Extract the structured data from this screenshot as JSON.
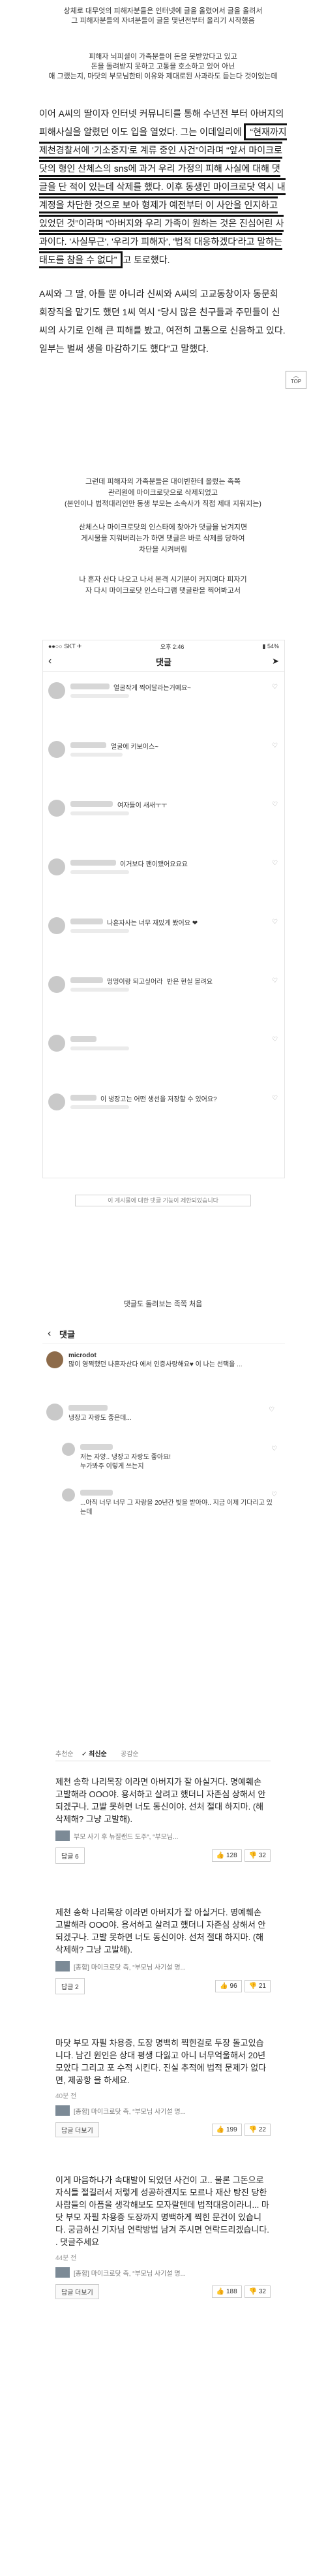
{
  "intro_lines": [
    "상체로 대무엇의 피해자분들은 인터넷에 글을 올렸어서 글을 올려서",
    "그 피해자분들의 자녀분들이 글을 몇년전부터 올리기 시작했음",
    "피해자 뇌피셜이 가족분들이 돈을 못받았다고 있고",
    "돈을 돌려받지 못하고 고통을 호소하고 있어 아닌",
    "애 그랬는지, 마닷의 부모님한테 이유와 제대로된 사과라도 듣는다 것이었는데"
  ],
  "article": {
    "p1_before": "이어 A씨의 딸이자 인터넷 커뮤니티를 통해 수년전 부터 아버지의 피해사실을 알렸던 이도 입을 열었다. 그는 이데일리에 ",
    "boxed": "“현재까지 제천경찰서에 '기소중지'로 계류 중인 사건”이라며 “앞서 마이크로닷의 형인 산체스의 sns에 과거 우리 가정의 피해 사실에 대해 댓글을 단 적이 있는데 삭제를 했다. 이후 동생인 마이크로닷 역시 내 계정을 차단한 것으로 보아 형제가 예전부터 이 사안을 인지하고 있었던 것”이라며 “아버지와 우리 가족이 원하는 것은 진심어린 사과이다. '사실무근', '우리가 피해자', '법적 대응하겠다'라고 말하는 태도를 참을 수 없다”",
    "p1_after": "고 토로했다.",
    "p2": "A씨와 그 딸, 아들 뿐 아니라 신씨와 A씨의 고교동창이자 동문회 회장직을 맡기도 했던 1씨 역시 “당시 많은 친구들과 주민들이 신 씨의 사기로 인해 큰 피해를 봤고, 여전히 고통으로 신음하고 있다. 일부는 벌써 생을 마감하기도 했다”고 말했다."
  },
  "top_button": "TOP",
  "middle_lines": [
    "그런데 피해자의 가족분들은 대이빈한테 올렸는 족쪽",
    "관리원에 마이크로닷으로 삭제되었고",
    "(본인이나 법적대리인만 동생 부모는 소속사가 직접 제대 지워지는)",
    "산체스나 마이크로닷의 인스타에 찾아가 댓글을 남겨지면",
    "게시물을 지워버리는가 하면 댓글은 바로 삭제를 당하여",
    "차단을 시켜버림",
    "나 혼자 산다 나오고 나서 본격 시기분이 커지며다 피자기",
    "자 다시 마이크로닷 인스타그램 댓글란을 찍어봐고서"
  ],
  "phone1": {
    "status_left": "●●○○ SKT ✈",
    "status_time": "오후 2:46",
    "status_right": "▮ 54%",
    "title": "댓글",
    "comments": [
      "얼굴작게 찍어달라는거예요~",
      "얼굴에 키보이스~",
      "여자들이 새새ㅜㅜ",
      "이거보다 팬이됐어요요요",
      "나혼자사는 너무 재밌게 봤어요 ❤",
      "멍멍이랑 되고싶어라 ",
      "반은 현실 볼려요",
      "이 냉장고는 어떤 생선을 저장할 수 있어요?"
    ]
  },
  "phone1_caption": "이 게시물에 대한 댓글 기능이 제한되었습니다",
  "section_caption": "댓글도 돌려보는 족쪽 처음",
  "phone2": {
    "title": "댓글",
    "comments": [
      {
        "handle": "microdot",
        "text": "많이 영쩍했던 나혼자산다 에서 인증사랑해요♥ 이 나는 선택을 ..."
      },
      {
        "handle": "",
        "text": "냉장고 자랑도 좋은데..."
      },
      {
        "handle": "",
        "text": "저는 자양.. 냉장고 자랑도 좋아요!"
      },
      {
        "handle": "",
        "text": "누가봐주 이렇게 쓰는지"
      },
      {
        "handle": "",
        "text": "...아직 너무 너무 그 자랑을 20년간 빚을 받아야.. 지금 이제 기다리고 있는데"
      }
    ]
  },
  "tabs": {
    "newest": "✓ 최신순",
    "other1": "공감순",
    "other2": "추천순"
  },
  "comments": [
    {
      "body": "제천 송학 나리목장 이라면 아버지가 잘 아실거다. 명예훼손 고발해라 OOO야. 용서하고 살려고 했더니 자존심 상해서 안되겠구나. 고발 못하면 너도 동신이야. 선처 절대 하지마. (해 삭제해? 그냥 고발해).",
      "news": "부모 사기 후 뉴질랜드 도주“, “부모님...",
      "reply": "답글 6",
      "up": "👍 128",
      "down": "👎 32"
    },
    {
      "body": "제천 송학 나리목장 이라면 아버지가 잘 아실거다. 명예훼손 고발해라 OOO야. 용서하고 살려고 했더니 자존심 상해서 안되겠구나. 고발 못하면 너도 동신이야. 선처 절대 하지마. (해 삭제해? 그냥 고발해).",
      "news": "[종합] 마이크로닷 측, “부모님 사기설 명...",
      "reply": "답글 2",
      "up": "👍 96",
      "down": "👎 21"
    },
    {
      "body": "마닷 부모 자필 차용증, 도장 명백히 찍힌걸로 두장 돌고있습니다. 남긴 원인은 상대 평생 다잃고 아니 너무억울해서 20년 모았다 그리고 포 수적 시킨다. 진실 추적에 법적 문제가 없다면, 제공항 을 하세요.",
      "date": "40분 전",
      "news": "[종합] 마이크로닷 측, “부모님 사기설 명...",
      "more": "답글 더보기",
      "up": "👍 199",
      "down": "👎 22"
    },
    {
      "body": "이게 마음하나가 속대발이 되었던 사건이 고.. 물론 그돈으로 자식들 절길러서 저렇게 성공하겐지도 모르나 재산 탕진 당한사람들의 아픔을 생각해보도 모자랄텐데 법적대응이라니... 마닷 부모 자필 차용증 도장까지 명백하게 찍힌 문건이 있습니다. 궁금하신 기자님 연락방법 남겨 주시면 연락드리겠습니다. . 댓글주세요",
      "date": "44분 전",
      "news": "[종합] 마이크로닷 측, “부모님 사기설 명...",
      "more": "답글 더보기",
      "up": "👍 188",
      "down": "👎 32"
    }
  ]
}
